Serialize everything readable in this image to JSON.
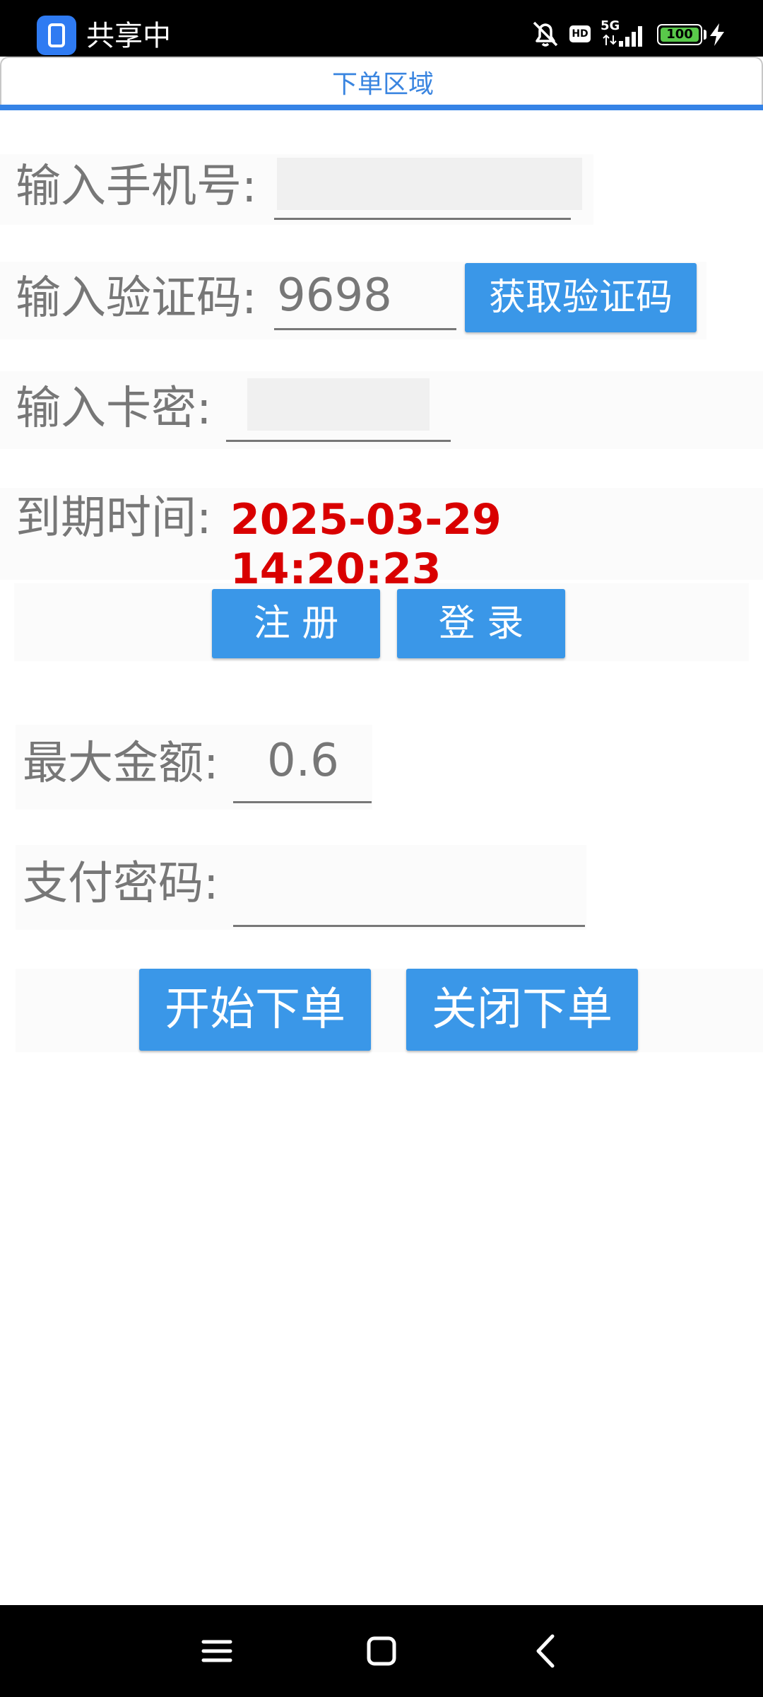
{
  "status_bar": {
    "title": "共享中",
    "network": "5G",
    "hd": "HD",
    "battery": "100"
  },
  "tab": {
    "label": "下单区域"
  },
  "form": {
    "phone_label": "输入手机号:",
    "phone_value": "",
    "code_label": "输入验证码:",
    "code_value": "9698",
    "get_code_button": "获取验证码",
    "card_label": "输入卡密:",
    "card_value": "",
    "expire_label": "到期时间:",
    "expire_date": "2025-03-29",
    "expire_time": "14:20:23",
    "register_button": "注 册",
    "login_button": "登 录"
  },
  "order": {
    "max_amount_label": "最大金额:",
    "max_amount_value": "0.6",
    "pay_password_label": "支付密码:",
    "pay_password_value": "",
    "start_button": "开始下单",
    "close_button": "关闭下单"
  },
  "nav_bar": {
    "menu_icon": "menu-icon",
    "home_icon": "home-icon",
    "back_icon": "back-icon"
  },
  "colors": {
    "accent": "#3a97e8",
    "tab_text": "#3a85e0",
    "expire_text": "#d90000"
  }
}
